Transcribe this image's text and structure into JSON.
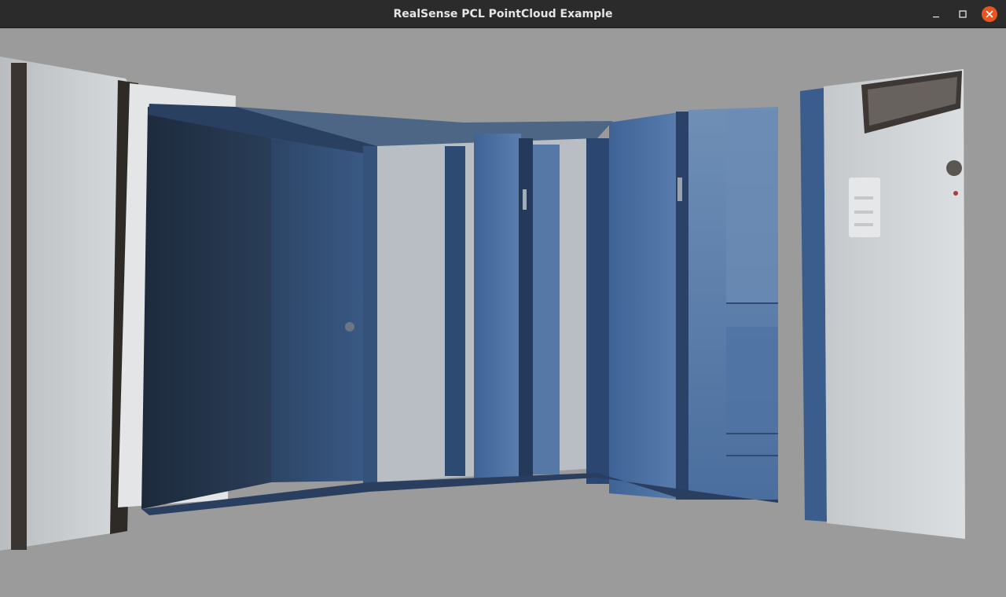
{
  "window": {
    "title": "RealSense PCL PointCloud Example"
  },
  "titlebar_controls": {
    "minimize_icon": "minimize-icon",
    "maximize_icon": "maximize-icon",
    "close_icon": "close-icon"
  },
  "colors": {
    "titlebar_bg": "#2b2b2b",
    "viewport_bg": "#9b9b9b",
    "close_accent": "#e95420",
    "door_blue": "#3e5f8e",
    "wall_white": "#cfd3d6"
  }
}
